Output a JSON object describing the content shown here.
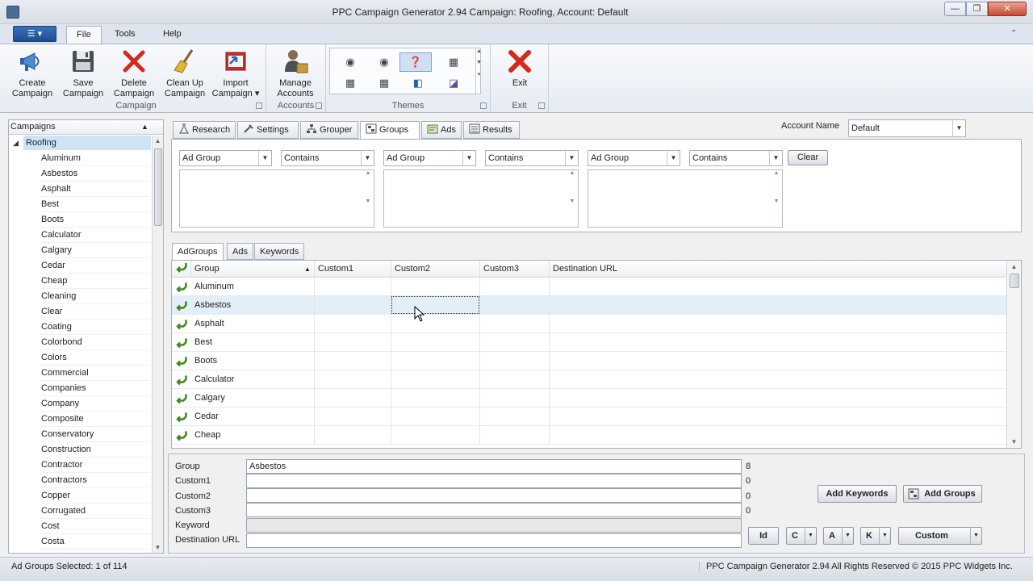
{
  "window": {
    "title": "PPC Campaign Generator 2.94 Campaign: Roofing, Account: Default",
    "min_label": "—",
    "max_label": "❐",
    "close_label": "✕"
  },
  "ribbon_tabs": [
    "File",
    "Tools",
    "Help"
  ],
  "app_menu_label": "☰ ▾",
  "ribbon": {
    "campaign_group": {
      "label": "Campaign",
      "buttons": [
        {
          "line1": "Create",
          "line2": "Campaign"
        },
        {
          "line1": "Save",
          "line2": "Campaign"
        },
        {
          "line1": "Delete",
          "line2": "Campaign"
        },
        {
          "line1": "Clean Up",
          "line2": "Campaign"
        },
        {
          "line1": "Import",
          "line2": "Campaign ▾"
        }
      ]
    },
    "accounts_group": {
      "label": "Accounts",
      "button": {
        "line1": "Manage",
        "line2": "Accounts"
      }
    },
    "themes_group": {
      "label": "Themes"
    },
    "exit_group": {
      "label": "Exit",
      "button": "Exit"
    }
  },
  "left_panel": {
    "header": "Campaigns",
    "root": "Roofing",
    "items": [
      "Aluminum",
      "Asbestos",
      "Asphalt",
      "Best",
      "Boots",
      "Calculator",
      "Calgary",
      "Cedar",
      "Cheap",
      "Cleaning",
      "Clear",
      "Coating",
      "Colorbond",
      "Colors",
      "Commercial",
      "Companies",
      "Company",
      "Composite",
      "Conservatory",
      "Construction",
      "Contractor",
      "Contractors",
      "Copper",
      "Corrugated",
      "Cost",
      "Costa"
    ]
  },
  "main_tabs": [
    "Research",
    "Settings",
    "Grouper",
    "Groups",
    "Ads",
    "Results"
  ],
  "account": {
    "label": "Account Name",
    "value": "Default"
  },
  "filters": [
    {
      "field": "Ad Group",
      "op": "Contains"
    },
    {
      "field": "Ad Group",
      "op": "Contains"
    },
    {
      "field": "Ad Group",
      "op": "Contains"
    }
  ],
  "clear_label": "Clear",
  "sub_tabs": [
    "AdGroups",
    "Ads",
    "Keywords"
  ],
  "grid": {
    "columns": [
      "Group",
      "Custom1",
      "Custom2",
      "Custom3",
      "Destination URL"
    ],
    "rows": [
      "Aluminum",
      "Asbestos",
      "Asphalt",
      "Best",
      "Boots",
      "Calculator",
      "Calgary",
      "Cedar",
      "Cheap"
    ],
    "selected_row": "Asbestos"
  },
  "detail": {
    "labels": [
      "Group",
      "Custom1",
      "Custom2",
      "Custom3",
      "Keyword",
      "Destination URL"
    ],
    "group_value": "Asbestos",
    "counts": [
      "8",
      "0",
      "0",
      "0"
    ],
    "add_keywords": "Add Keywords",
    "add_groups": "Add Groups",
    "id_btn": "Id",
    "c_btn": "C",
    "a_btn": "A",
    "k_btn": "K",
    "custom_btn": "Custom"
  },
  "status": {
    "left": "Ad Groups Selected: 1 of 114",
    "right": "PPC Campaign Generator 2.94 All Rights Reserved © 2015 PPC Widgets Inc."
  },
  "colors": {
    "accent": "#1b4d93",
    "selection": "#cfe3f7",
    "exit_red": "#d42a1e"
  }
}
